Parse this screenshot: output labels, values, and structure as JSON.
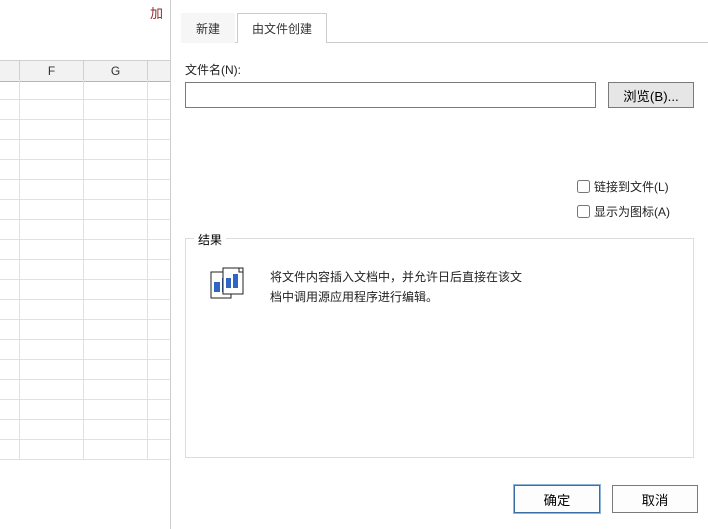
{
  "sheet": {
    "ribbon_hint_fragment": "加",
    "columns": [
      "",
      "F",
      "G"
    ]
  },
  "dialog": {
    "tabs": {
      "new_label": "新建",
      "from_file_label": "由文件创建"
    },
    "filename_label": "文件名(N):",
    "filename_value": "",
    "browse_button": "浏览(B)...",
    "link_to_file_label": "链接到文件(L)",
    "display_as_icon_label": "显示为图标(A)",
    "result_legend": "结果",
    "result_description": "将文件内容插入文档中，并允许日后直接在该文档中调用源应用程序进行编辑。",
    "ok_button": "确定",
    "cancel_button": "取消"
  }
}
